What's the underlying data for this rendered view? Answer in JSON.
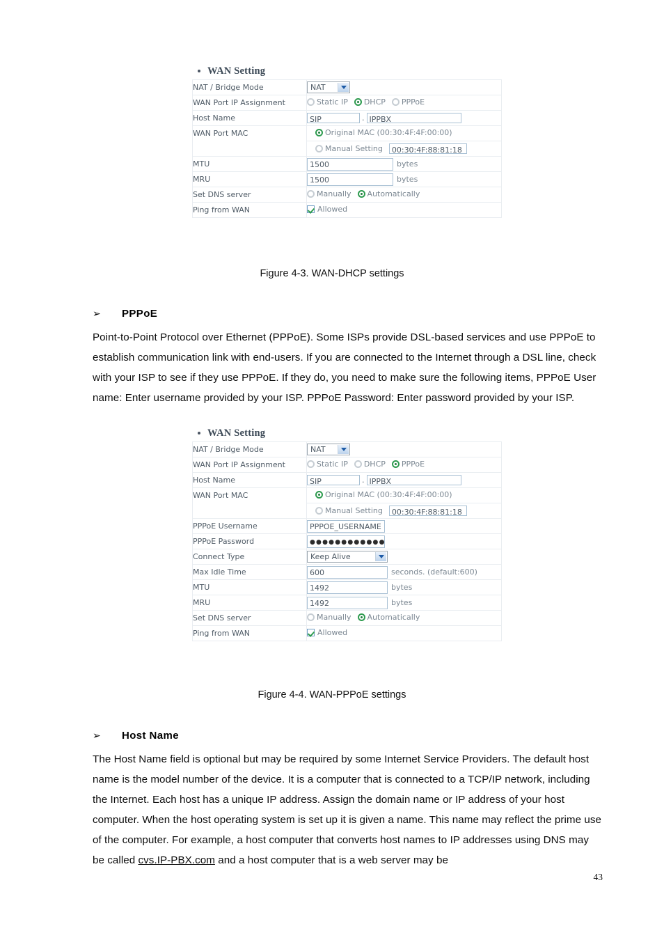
{
  "page": {
    "number": "43"
  },
  "figure1": {
    "caption": "Figure 4-3. WAN-DHCP settings",
    "panel_title": "WAN Setting",
    "rows": {
      "nat_bridge_mode": {
        "label": "NAT / Bridge Mode",
        "value": "NAT"
      },
      "wan_port_ip_assignment": {
        "label": "WAN Port IP Assignment",
        "options": [
          "Static IP",
          "DHCP",
          "PPPoE"
        ],
        "selected": "DHCP"
      },
      "host_name": {
        "label": "Host Name",
        "value1": "SIP",
        "separator": ".",
        "value2": "IPPBX"
      },
      "wan_port_mac": {
        "label": "WAN Port MAC",
        "original_label": "Original MAC (00:30:4F:4F:00:00)",
        "manual_label": "Manual Setting",
        "manual_value": "00:30:4F:88:81:18",
        "selected": "Original MAC (00:30:4F:4F:00:00)"
      },
      "mtu": {
        "label": "MTU",
        "value": "1500",
        "unit": "bytes"
      },
      "mru": {
        "label": "MRU",
        "value": "1500",
        "unit": "bytes"
      },
      "set_dns_server": {
        "label": "Set DNS server",
        "options": [
          "Manually",
          "Automatically"
        ],
        "selected": "Automatically"
      },
      "ping_from_wan": {
        "label": "Ping from WAN",
        "checkbox_label": "Allowed",
        "checked": true
      }
    }
  },
  "pppoe_section": {
    "bullet": "➢",
    "heading": "PPPoE",
    "body": "Point-to-Point Protocol over Ethernet (PPPoE). Some ISPs provide DSL-based services and use PPPoE to establish communication link with end-users. If you are connected to the Internet through a DSL line, check with your ISP to see if they use PPPoE. If they do, you need to make sure the following items, PPPoE User name: Enter username provided by your ISP. PPPoE Password: Enter password provided by your ISP."
  },
  "figure2": {
    "caption": "Figure 4-4. WAN-PPPoE settings",
    "panel_title": "WAN Setting",
    "rows": {
      "nat_bridge_mode": {
        "label": "NAT / Bridge Mode",
        "value": "NAT"
      },
      "wan_port_ip_assignment": {
        "label": "WAN Port IP Assignment",
        "options": [
          "Static IP",
          "DHCP",
          "PPPoE"
        ],
        "selected": "PPPoE"
      },
      "host_name": {
        "label": "Host Name",
        "value1": "SIP",
        "separator": ".",
        "value2": "IPPBX"
      },
      "wan_port_mac": {
        "label": "WAN Port MAC",
        "original_label": "Original MAC (00:30:4F:4F:00:00)",
        "manual_label": "Manual Setting",
        "manual_value": "00:30:4F:88:81:18",
        "selected": "Original MAC (00:30:4F:4F:00:00)"
      },
      "pppoe_username": {
        "label": "PPPoE Username",
        "value": "PPPOE_USERNAME"
      },
      "pppoe_password": {
        "label": "PPPoE Password",
        "value": "●●●●●●●●●●●●●●"
      },
      "connect_type": {
        "label": "Connect Type",
        "value": "Keep Alive"
      },
      "max_idle_time": {
        "label": "Max Idle Time",
        "value": "600",
        "unit": "seconds. (default:600)"
      },
      "mtu": {
        "label": "MTU",
        "value": "1492",
        "unit": "bytes"
      },
      "mru": {
        "label": "MRU",
        "value": "1492",
        "unit": "bytes"
      },
      "set_dns_server": {
        "label": "Set DNS server",
        "options": [
          "Manually",
          "Automatically"
        ],
        "selected": "Automatically"
      },
      "ping_from_wan": {
        "label": "Ping from WAN",
        "checkbox_label": "Allowed",
        "checked": true
      }
    }
  },
  "hostname_section": {
    "bullet": "➢",
    "heading": "Host Name",
    "body_part1": "The Host Name field is optional but may be required by some Internet Service Providers. The default host name is the model number of the device. It is a computer that is connected to a TCP/IP network, including the Internet. Each host has a unique IP address. Assign the domain name or IP address of your host computer. When the host operating system is set up it is given a name. This name may reflect the prime use of the computer. For example, a host computer that converts host names to IP addresses using DNS may be called ",
    "link": "cvs.IP-PBX.com",
    "body_part2": " and a host computer that is a web server may be"
  },
  "colors": {
    "radio_selected": "#2e9b4f",
    "checkbox_check": "#2e9b4f",
    "input_border": "#a8c0d4",
    "table_grid": "#e9edf1",
    "label_text": "#4f5b66",
    "option_text": "#7b8792",
    "panel_title": "#3d4a57"
  }
}
